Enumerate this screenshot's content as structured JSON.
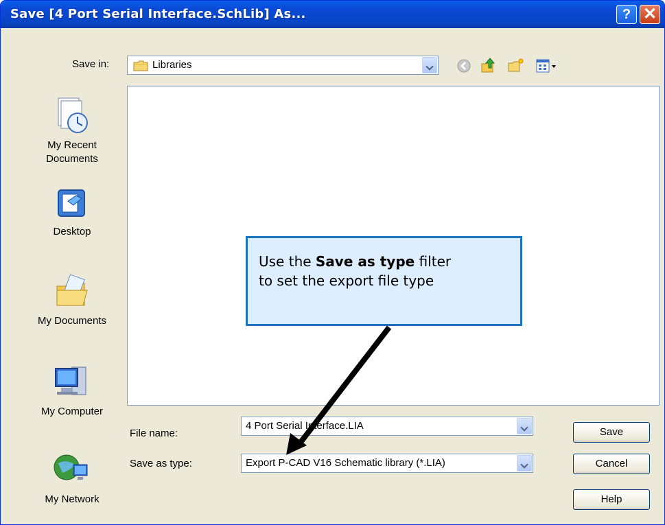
{
  "window": {
    "title": "Save [4 Port Serial Interface.SchLib] As..."
  },
  "titlebar": {
    "help_glyph": "?",
    "close_glyph": "✕"
  },
  "save_in": {
    "label": "Save in:",
    "value": "Libraries"
  },
  "toolbar": {
    "icons": [
      "back-icon",
      "up-folder-icon",
      "new-folder-icon",
      "views-menu-icon"
    ]
  },
  "places": [
    {
      "label_lines": [
        "My Recent",
        "Documents"
      ],
      "icon": "recent-documents-icon"
    },
    {
      "label_lines": [
        "Desktop"
      ],
      "icon": "desktop-icon"
    },
    {
      "label_lines": [
        "My Documents"
      ],
      "icon": "my-documents-icon"
    },
    {
      "label_lines": [
        "My Computer"
      ],
      "icon": "my-computer-icon"
    },
    {
      "label_lines": [
        "My Network"
      ],
      "icon": "my-network-icon"
    }
  ],
  "file_name": {
    "label": "File name:",
    "value": "4 Port Serial Interface.LIA"
  },
  "save_as_type": {
    "label": "Save as type:",
    "value": "Export P-CAD V16 Schematic library (*.LIA)"
  },
  "buttons": {
    "save": "Save",
    "cancel": "Cancel",
    "help": "Help"
  },
  "callout": {
    "before": "Use the ",
    "bold": "Save as type",
    "after": " filter",
    "line2": "to set the export file type"
  }
}
